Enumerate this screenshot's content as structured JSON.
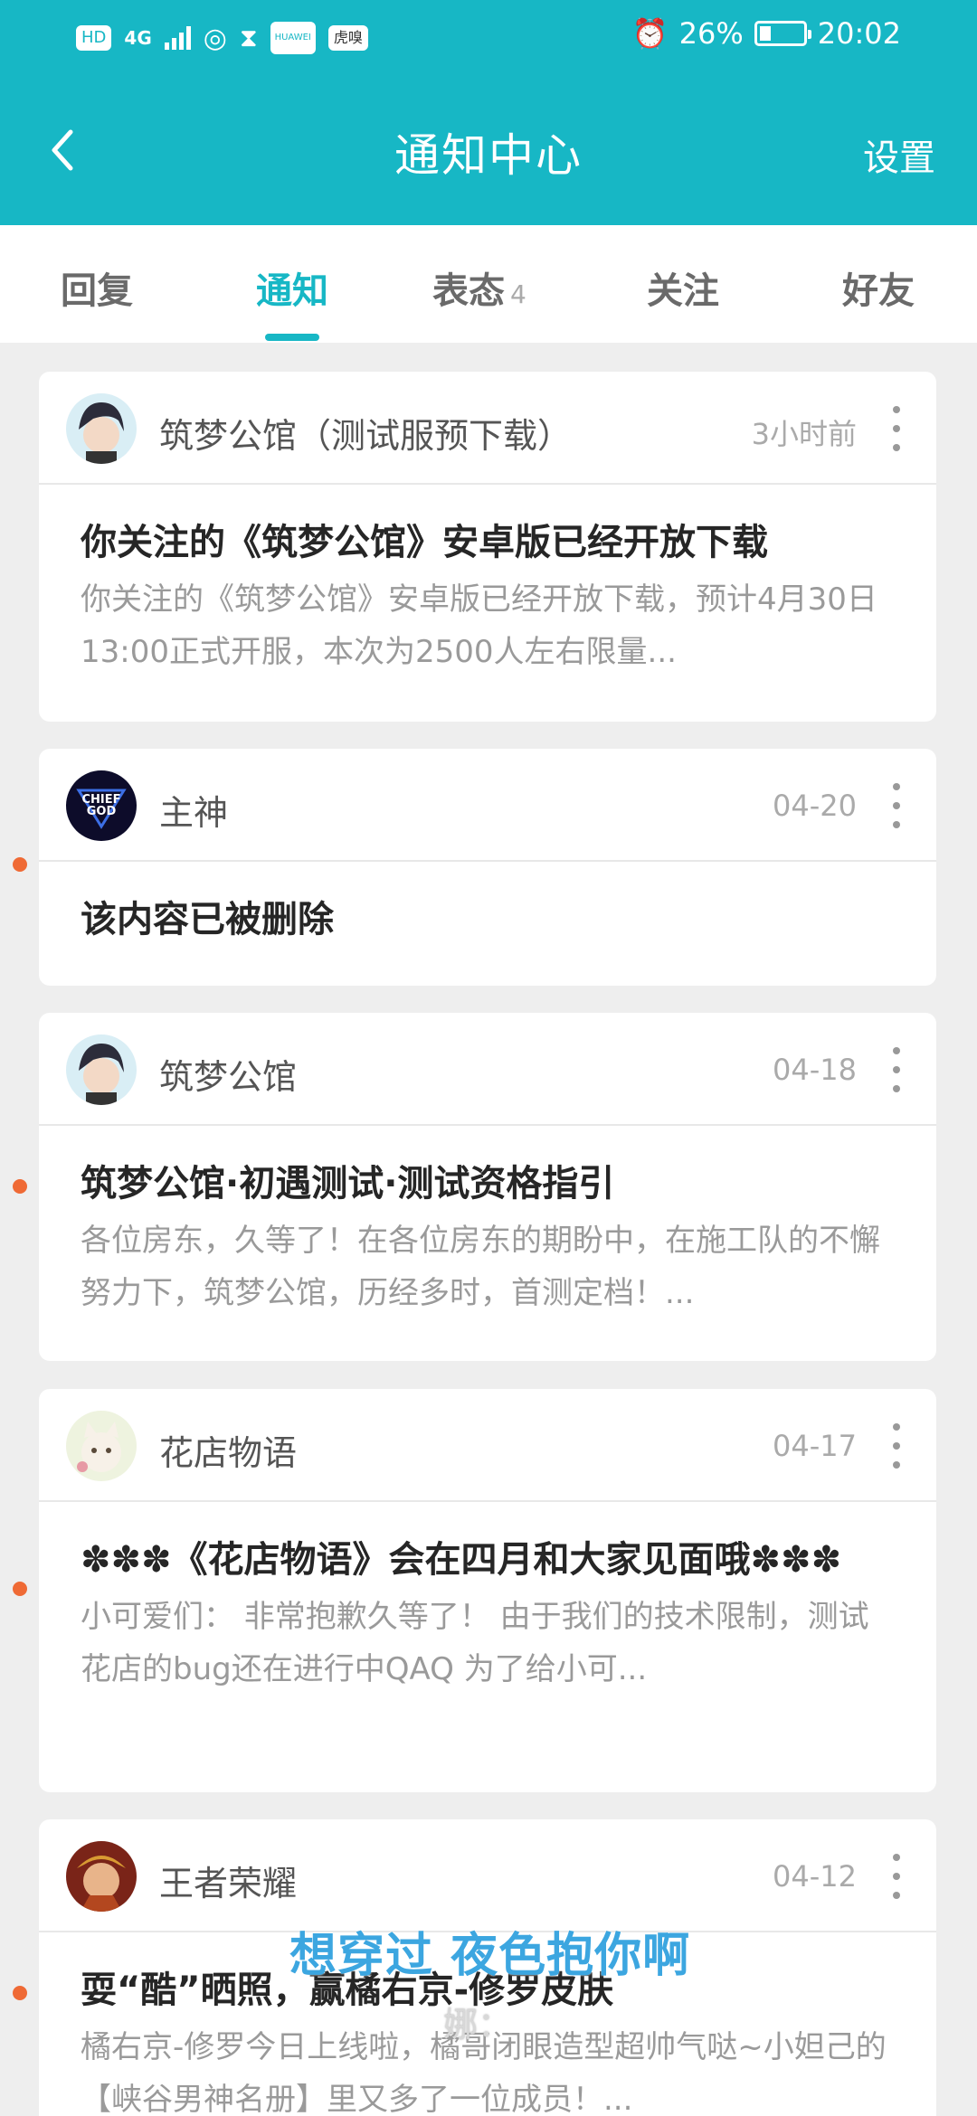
{
  "status_bar": {
    "badges": [
      "HD",
      "4G"
    ],
    "app_icons": [
      "hourglass-icon",
      "huawei-app-icon",
      "huya-app-icon"
    ],
    "battery": "26%",
    "battery_level": 0.26,
    "time": "20:02",
    "huya_label": "虎嗅",
    "huawei_label": "HUAWEI"
  },
  "header": {
    "title": "通知中心",
    "settings_label": "设置"
  },
  "tabs": [
    {
      "label": "回复",
      "count": ""
    },
    {
      "label": "通知",
      "count": ""
    },
    {
      "label": "表态",
      "count": "4"
    },
    {
      "label": "关注",
      "count": ""
    },
    {
      "label": "好友",
      "count": ""
    }
  ],
  "active_tab": "通知",
  "notifications": [
    {
      "author": "筑梦公馆（测试服预下载）",
      "time": "3小时前",
      "headline": "你关注的《筑梦公馆》安卓版已经开放下载",
      "excerpt": "你关注的《筑梦公馆》安卓版已经开放下载，预计4月30日13:00正式开服，本次为2500人左右限量...",
      "unread": false,
      "avatar": "anime-boy-avatar"
    },
    {
      "author": "主神",
      "time": "04-20",
      "headline": "该内容已被删除",
      "excerpt": "",
      "unread": true,
      "avatar": "chief-god-avatar",
      "avatar_text": [
        "CHIEF",
        "GOD"
      ]
    },
    {
      "author": "筑梦公馆",
      "time": "04-18",
      "headline": "筑梦公馆·初遇测试·测试资格指引",
      "excerpt": "各位房东，久等了！在各位房东的期盼中，在施工队的不懈努力下，筑梦公馆，历经多时，首测定档！...",
      "unread": true,
      "avatar": "anime-boy-avatar"
    },
    {
      "author": "花店物语",
      "time": "04-17",
      "headline": "✽✽✽《花店物语》会在四月和大家见面哦✽✽✽",
      "excerpt": "小可爱们：  非常抱歉久等了！  由于我们的技术限制，测试花店的bug还在进行中QAQ 为了给小可...",
      "unread": true,
      "avatar": "cat-avatar"
    },
    {
      "author": "王者荣耀",
      "time": "04-12",
      "headline": "耍“酷”晒照，赢橘右京-修罗皮肤",
      "excerpt": "橘右京-修罗今日上线啦，橘哥闭眼造型超帅气哒~小妲己的【峡谷男神名册】里又多了一位成员！...",
      "unread": true,
      "avatar": "honor-of-kings-avatar"
    }
  ],
  "overlay": {
    "caption": "想穿过 夜色抱你啊",
    "sub": "娜："
  },
  "colors": {
    "accent": "#17b7c5",
    "unread_dot": "#ef6a35",
    "background": "#eeeeee"
  }
}
